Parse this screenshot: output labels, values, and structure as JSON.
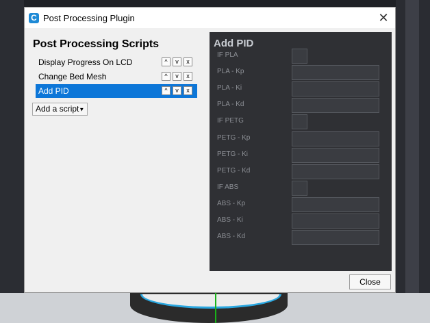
{
  "window": {
    "title": "Post Processing Plugin",
    "icon": "cura-logo-icon",
    "close_glyph": "✕"
  },
  "left": {
    "title": "Post Processing Scripts",
    "scripts": [
      {
        "label": "Display Progress On LCD",
        "selected": false
      },
      {
        "label": "Change Bed Mesh",
        "selected": false
      },
      {
        "label": "Add PID",
        "selected": true
      }
    ],
    "add_script_label": "Add a script",
    "script_buttons": {
      "up": "^",
      "down": "v",
      "remove": "x"
    }
  },
  "settings": {
    "title": "Add PID",
    "fields": [
      {
        "label": "IF PLA",
        "kind": "checkbox"
      },
      {
        "label": "PLA - Kp",
        "kind": "text"
      },
      {
        "label": "PLA - Ki",
        "kind": "text"
      },
      {
        "label": "PLA - Kd",
        "kind": "text"
      },
      {
        "label": "IF PETG",
        "kind": "checkbox"
      },
      {
        "label": "PETG - Kp",
        "kind": "text"
      },
      {
        "label": "PETG - Ki",
        "kind": "text"
      },
      {
        "label": "PETG - Kd",
        "kind": "text"
      },
      {
        "label": "IF ABS",
        "kind": "checkbox"
      },
      {
        "label": "ABS - Kp",
        "kind": "text"
      },
      {
        "label": "ABS - Ki",
        "kind": "text"
      },
      {
        "label": "ABS - Kd",
        "kind": "text"
      }
    ]
  },
  "footer": {
    "close_label": "Close"
  },
  "colors": {
    "accent": "#0c76d8",
    "settings_bg": "#2f3034"
  }
}
